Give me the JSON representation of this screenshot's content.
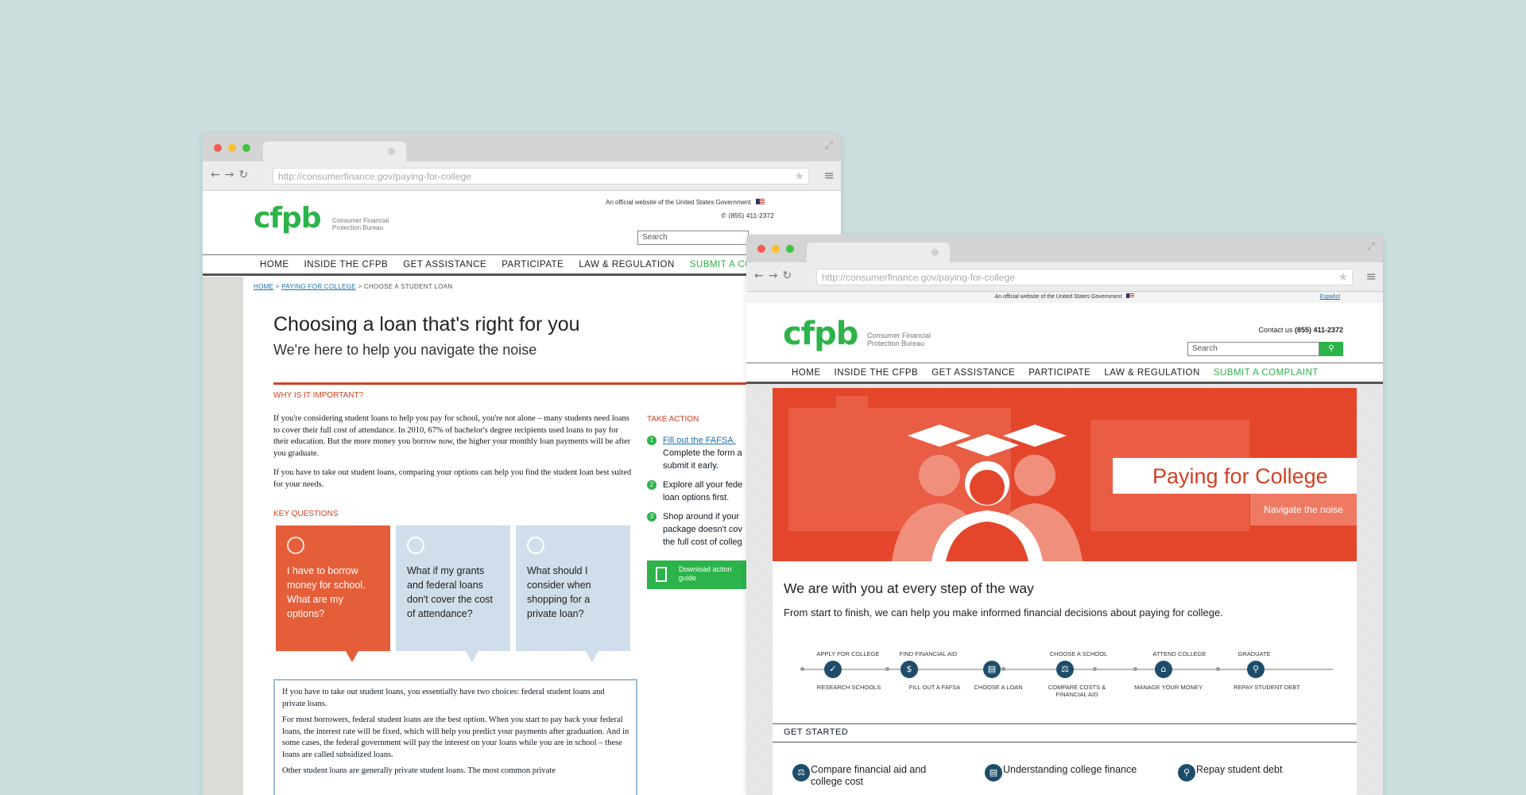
{
  "colors": {
    "accent": "#2cb34a",
    "red": "#d14124",
    "navy": "#1d4d6a",
    "bg": "#c9dedd"
  },
  "left": {
    "url": "http://consumerfinance.gov/paying-for-college",
    "official": "An official website of the United States Government",
    "phone": "(855) 411-2372",
    "search_placeholder": "Search",
    "logo": "cfpb",
    "logo_sub1": "Consumer Financial",
    "logo_sub2": "Protection Bureau",
    "nav": [
      "HOME",
      "INSIDE THE CFPB",
      "GET ASSISTANCE",
      "PARTICIPATE",
      "LAW & REGULATION",
      "SUBMIT A CO"
    ],
    "breadcrumb": {
      "home": "HOME",
      "sep1": ">",
      "pfc": "PAYING FOR COLLEGE",
      "sep2": ">",
      "current": "CHOOSE A STUDENT LOAN"
    },
    "title": "Choosing a loan that's right for you",
    "subtitle": "We're here to help you navigate the noise",
    "why_heading": "WHY IS IT IMPORTANT?",
    "why_p1": "If you're considering student loans to help you pay for school, you're not alone – many students need loans to cover their full cost of attendance. In 2010, 67% of bachelor's degree recipients used loans to pay for their education. But the more money you borrow now, the higher your monthly loan payments will be after you graduate.",
    "why_p2": "If you have to take out student loans, comparing your options can help you find the student loan best suited for your needs.",
    "kq_heading": "KEY QUESTIONS",
    "cards": [
      {
        "text": "I have to borrow money for school. What are my options?",
        "icon": "clock-icon"
      },
      {
        "text": "What if my grants and federal loans don't cover the cost of attendance?",
        "icon": "dollar-icon"
      },
      {
        "text": "What should I consider when shopping for a private loan?",
        "icon": "bank-icon"
      }
    ],
    "answer_p1": "If you have to take out student loans, you essentially have two choices: federal student loans and private loans.",
    "answer_p2": "For most borrowers, federal student loans are the best option. When you start to pay back your federal loans, the interest rate will be fixed, which will help you predict your payments after graduation. And in some cases, the federal government will pay the interest on your loans while you are in school – these loans are called subsidized loans.",
    "answer_p3": "Other student loans are generally private student loans. The most common private",
    "take_action": "TAKE ACTION",
    "actions": [
      {
        "num": "1",
        "link": "Fill out the FAFSA.",
        "text": "Complete the form a submit it early."
      },
      {
        "num": "2",
        "link": "",
        "text": "Explore all your fede loan options first."
      },
      {
        "num": "3",
        "link": "",
        "text": "Shop around if your package doesn't cov the full cost of colleg"
      }
    ],
    "download": "Download action guide"
  },
  "right": {
    "url": "http://consumerfinance.gov/paying-for-college",
    "official": "An official website of the United States Government",
    "espanol": "Español",
    "logo": "cfpb",
    "logo_sub1": "Consumer Financial",
    "logo_sub2": "Protection Bureau",
    "contact_label": "Contact us",
    "phone": "(855) 411-2372",
    "search_placeholder": "Search",
    "nav": [
      "HOME",
      "INSIDE THE CFPB",
      "GET ASSISTANCE",
      "PARTICIPATE",
      "LAW & REGULATION",
      "SUBMIT A COMPLAINT"
    ],
    "hero_title": "Paying for College",
    "hero_button": "Navigate the noise",
    "headline": "We are with you at every step of the way",
    "intro": "From start to finish, we can help you make informed financial decisions about paying for college.",
    "steps_top": [
      "APPLY FOR COLLEGE",
      "FIND FINANCIAL AID",
      "CHOOSE A SCHOOL",
      "ATTEND COLLEGE",
      "GRADUATE"
    ],
    "steps_bottom": [
      "RESEARCH SCHOOLS",
      "FILL OUT A FAFSA",
      "CHOOSE A LOAN",
      "COMPARE COSTS & FINANCIAL AID",
      "MANAGE YOUR MONEY",
      "REPAY STUDENT DEBT"
    ],
    "get_started": "GET STARTED",
    "links": [
      {
        "text": "Compare financial aid and college cost",
        "icon": "scale-icon"
      },
      {
        "text": "Understanding college finance",
        "icon": "document-icon"
      },
      {
        "text": "Repay student debt",
        "icon": "graduate-icon"
      }
    ]
  }
}
